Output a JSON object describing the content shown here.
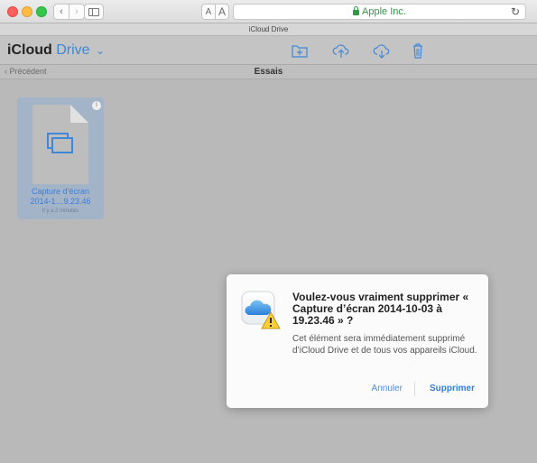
{
  "browser": {
    "nav_back": "‹",
    "nav_forward": "›",
    "font_smaller": "A",
    "font_larger": "A",
    "url": "Apple Inc.",
    "reload": "↻",
    "tab_title": "iCloud Drive"
  },
  "header": {
    "app_name": "iCloud",
    "app_section": "Drive",
    "chevron": "⌄",
    "icons": [
      "new-folder-icon",
      "upload-icon",
      "download-icon",
      "trash-icon"
    ]
  },
  "subheader": {
    "back_label": "‹ Précédent",
    "folder_title": "Essais"
  },
  "file": {
    "name_line1": "Capture d’écran",
    "name_line2": "2014-1…9.23.46",
    "age": "Il y a 2 minutes",
    "info": "i"
  },
  "dialog": {
    "title": "Voulez-vous vraiment supprimer « Capture d’écran 2014-10-03 à 19.23.46 » ?",
    "message": "Cet élément sera immédiatement supprimé d’iCloud Drive et de tous vos appareils iCloud.",
    "cancel_label": "Annuler",
    "delete_label": "Supprimer"
  },
  "colors": {
    "accent": "#3f87d9",
    "tile_selected": "#a3b4c9",
    "background": "#b9b9b9",
    "url_green": "#2f9a45"
  }
}
